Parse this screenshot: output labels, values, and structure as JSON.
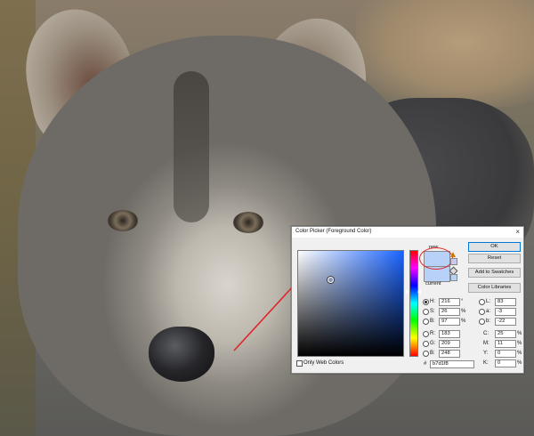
{
  "dialog": {
    "title": "Color Picker (Foreground Color)",
    "close_glyph": "×",
    "new_label": "new",
    "current_label": "current",
    "new_color": "#b7d1f8",
    "current_color": "#b7d1f8",
    "hue_color": "#1a64ff"
  },
  "buttons": {
    "ok": "OK",
    "reset": "Reset",
    "add_to_swatches": "Add to Swatches",
    "color_libraries": "Color Libraries"
  },
  "fields": {
    "H": {
      "label": "H:",
      "value": "216",
      "unit": "°",
      "selected": true
    },
    "S": {
      "label": "S:",
      "value": "26",
      "unit": "%"
    },
    "Bright": {
      "label": "B:",
      "value": "97",
      "unit": "%"
    },
    "R": {
      "label": "R:",
      "value": "183"
    },
    "G": {
      "label": "G:",
      "value": "209"
    },
    "Blue": {
      "label": "B:",
      "value": "248"
    },
    "L": {
      "label": "L:",
      "value": "83"
    },
    "a": {
      "label": "a:",
      "value": "-3"
    },
    "b": {
      "label": "b:",
      "value": "-22"
    },
    "C": {
      "label": "C:",
      "value": "25",
      "unit": "%"
    },
    "M": {
      "label": "M:",
      "value": "11",
      "unit": "%"
    },
    "Y": {
      "label": "Y:",
      "value": "0",
      "unit": "%"
    },
    "K": {
      "label": "K:",
      "value": "0",
      "unit": "%"
    }
  },
  "web_colors": {
    "label": "Only Web Colors",
    "checked": false
  },
  "hex": {
    "hash": "#",
    "value": "b7d1f8"
  },
  "annotation_color": "#e0262b"
}
